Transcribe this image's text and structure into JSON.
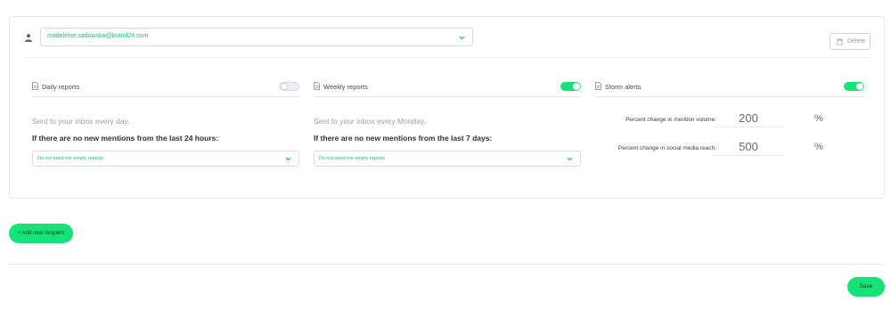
{
  "recipient": {
    "email": "madeleine.sadowska@brand24.com",
    "delete_label": "Delete"
  },
  "daily": {
    "title": "Daily reports",
    "enabled": false,
    "subtitle": "Sent to your inbox every day.",
    "question": "If there are no new mentions from the last 24 hours:",
    "selected": "Do not send me empty reports"
  },
  "weekly": {
    "title": "Weekly reports",
    "enabled": true,
    "subtitle": "Sent to your inbox every Monday.",
    "question": "If there are no new mentions from the last 7 days:",
    "selected": "Do not send me empty reports"
  },
  "storm": {
    "title": "Storm alerts",
    "enabled": true,
    "volume_label": "Percent change in mention volume:",
    "volume_value": "200",
    "reach_label": "Percent change in social media reach:",
    "reach_value": "500",
    "unit": "%"
  },
  "actions": {
    "add_label": "+ Add new recipient",
    "save_label": "Save"
  },
  "colors": {
    "accent": "#16e27a",
    "accent_text": "#1fbf6a"
  }
}
